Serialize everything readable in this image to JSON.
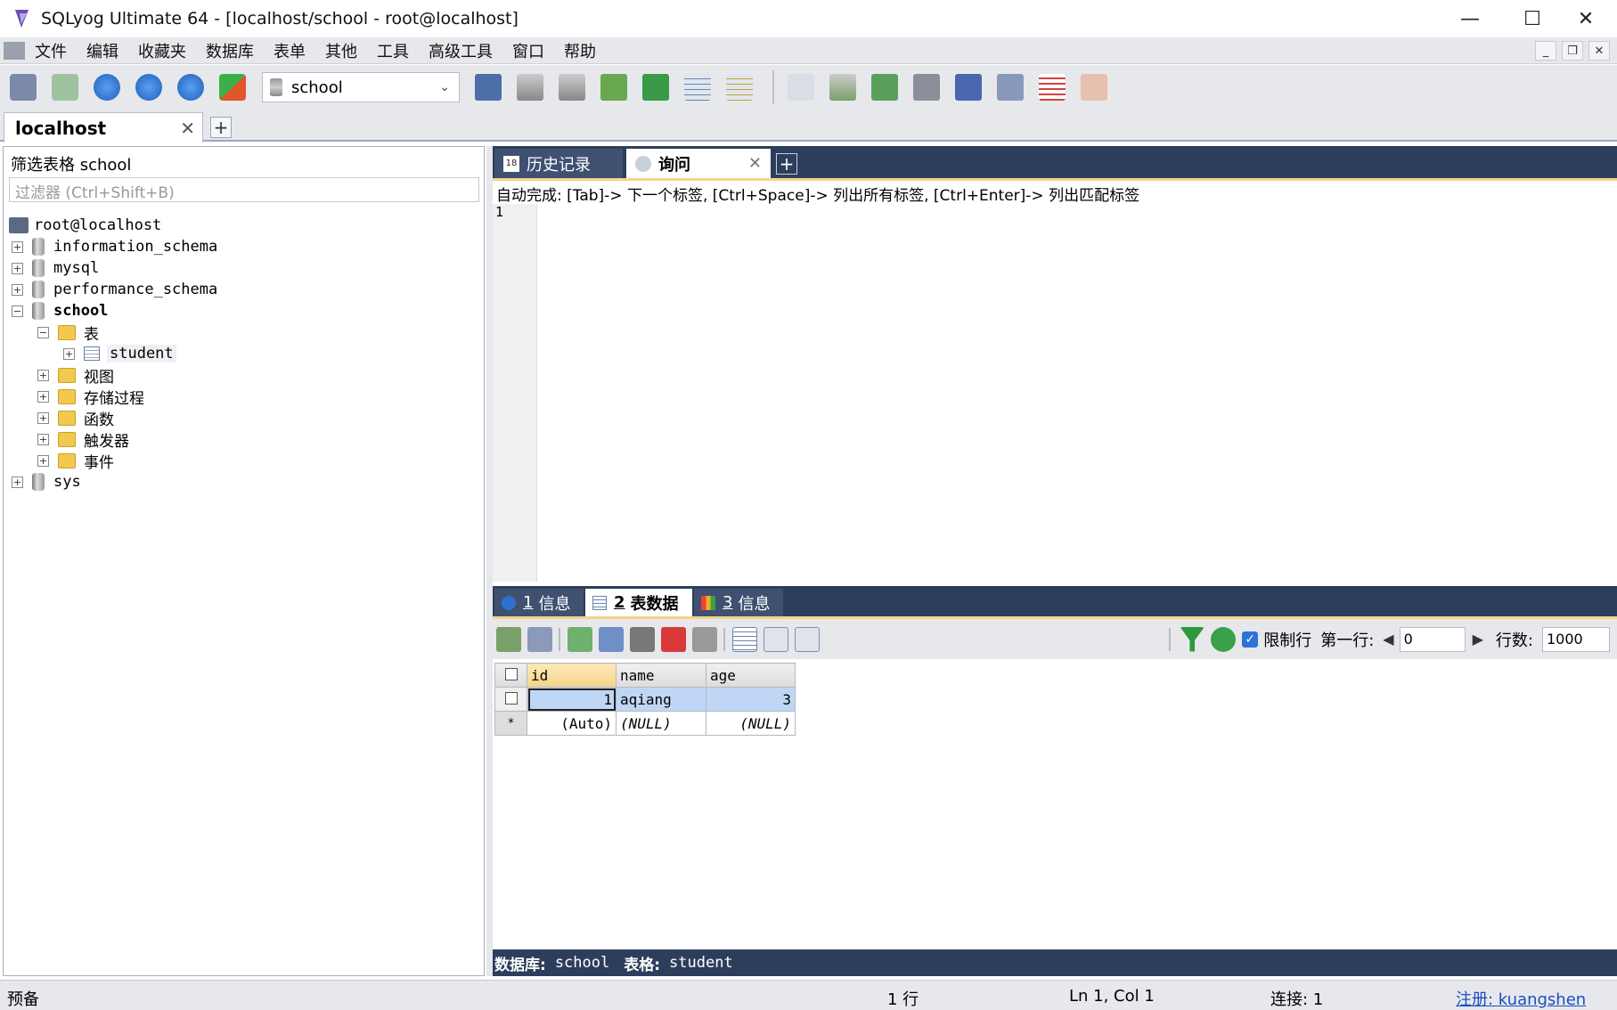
{
  "window": {
    "title": "SQLyog Ultimate 64 - [localhost/school - root@localhost]"
  },
  "menu": [
    "文件",
    "编辑",
    "收藏夹",
    "数据库",
    "表单",
    "其他",
    "工具",
    "高级工具",
    "窗口",
    "帮助"
  ],
  "toolbar": {
    "db_select": "school"
  },
  "connection_tab": {
    "label": "localhost"
  },
  "left": {
    "filter_label": "筛选表格 school",
    "filter_placeholder": "过滤器 (Ctrl+Shift+B)",
    "tree": {
      "root": "root@localhost",
      "db1": "information_schema",
      "db2": "mysql",
      "db3": "performance_schema",
      "db4": "school",
      "tables_folder": "表",
      "table1": "student",
      "views": "视图",
      "procs": "存储过程",
      "funcs": "函数",
      "triggers": "触发器",
      "events": "事件",
      "db5": "sys"
    }
  },
  "query_tabs": {
    "history": "历史记录",
    "query": "询问"
  },
  "editor": {
    "hint": "自动完成: [Tab]-> 下一个标签, [Ctrl+Space]-> 列出所有标签, [Ctrl+Enter]-> 列出匹配标签",
    "line_number": "1"
  },
  "result_tabs": {
    "t1_num": "1",
    "t1_label": "信息",
    "t2_num": "2",
    "t2_label": "表数据",
    "t3_num": "3",
    "t3_label": "信息"
  },
  "result_toolbar": {
    "limit_label": "限制行",
    "first_row_label": "第一行:",
    "first_row_value": "0",
    "rows_label": "行数:",
    "rows_value": "1000"
  },
  "grid": {
    "columns": [
      "id",
      "name",
      "age"
    ],
    "row1": {
      "id": "1",
      "name": "aqiang",
      "age": "3"
    },
    "new_row": {
      "marker": "*",
      "id": "(Auto)",
      "name": "(NULL)",
      "age": "(NULL)"
    }
  },
  "result_status": {
    "db_label": "数据库:",
    "db_value": "school",
    "table_label": "表格:",
    "table_value": "student"
  },
  "statusbar": {
    "ready": "预备",
    "rows": "1 行",
    "pos": "Ln 1, Col 1",
    "conn": "连接: 1",
    "reg": "注册: kuangshen"
  }
}
